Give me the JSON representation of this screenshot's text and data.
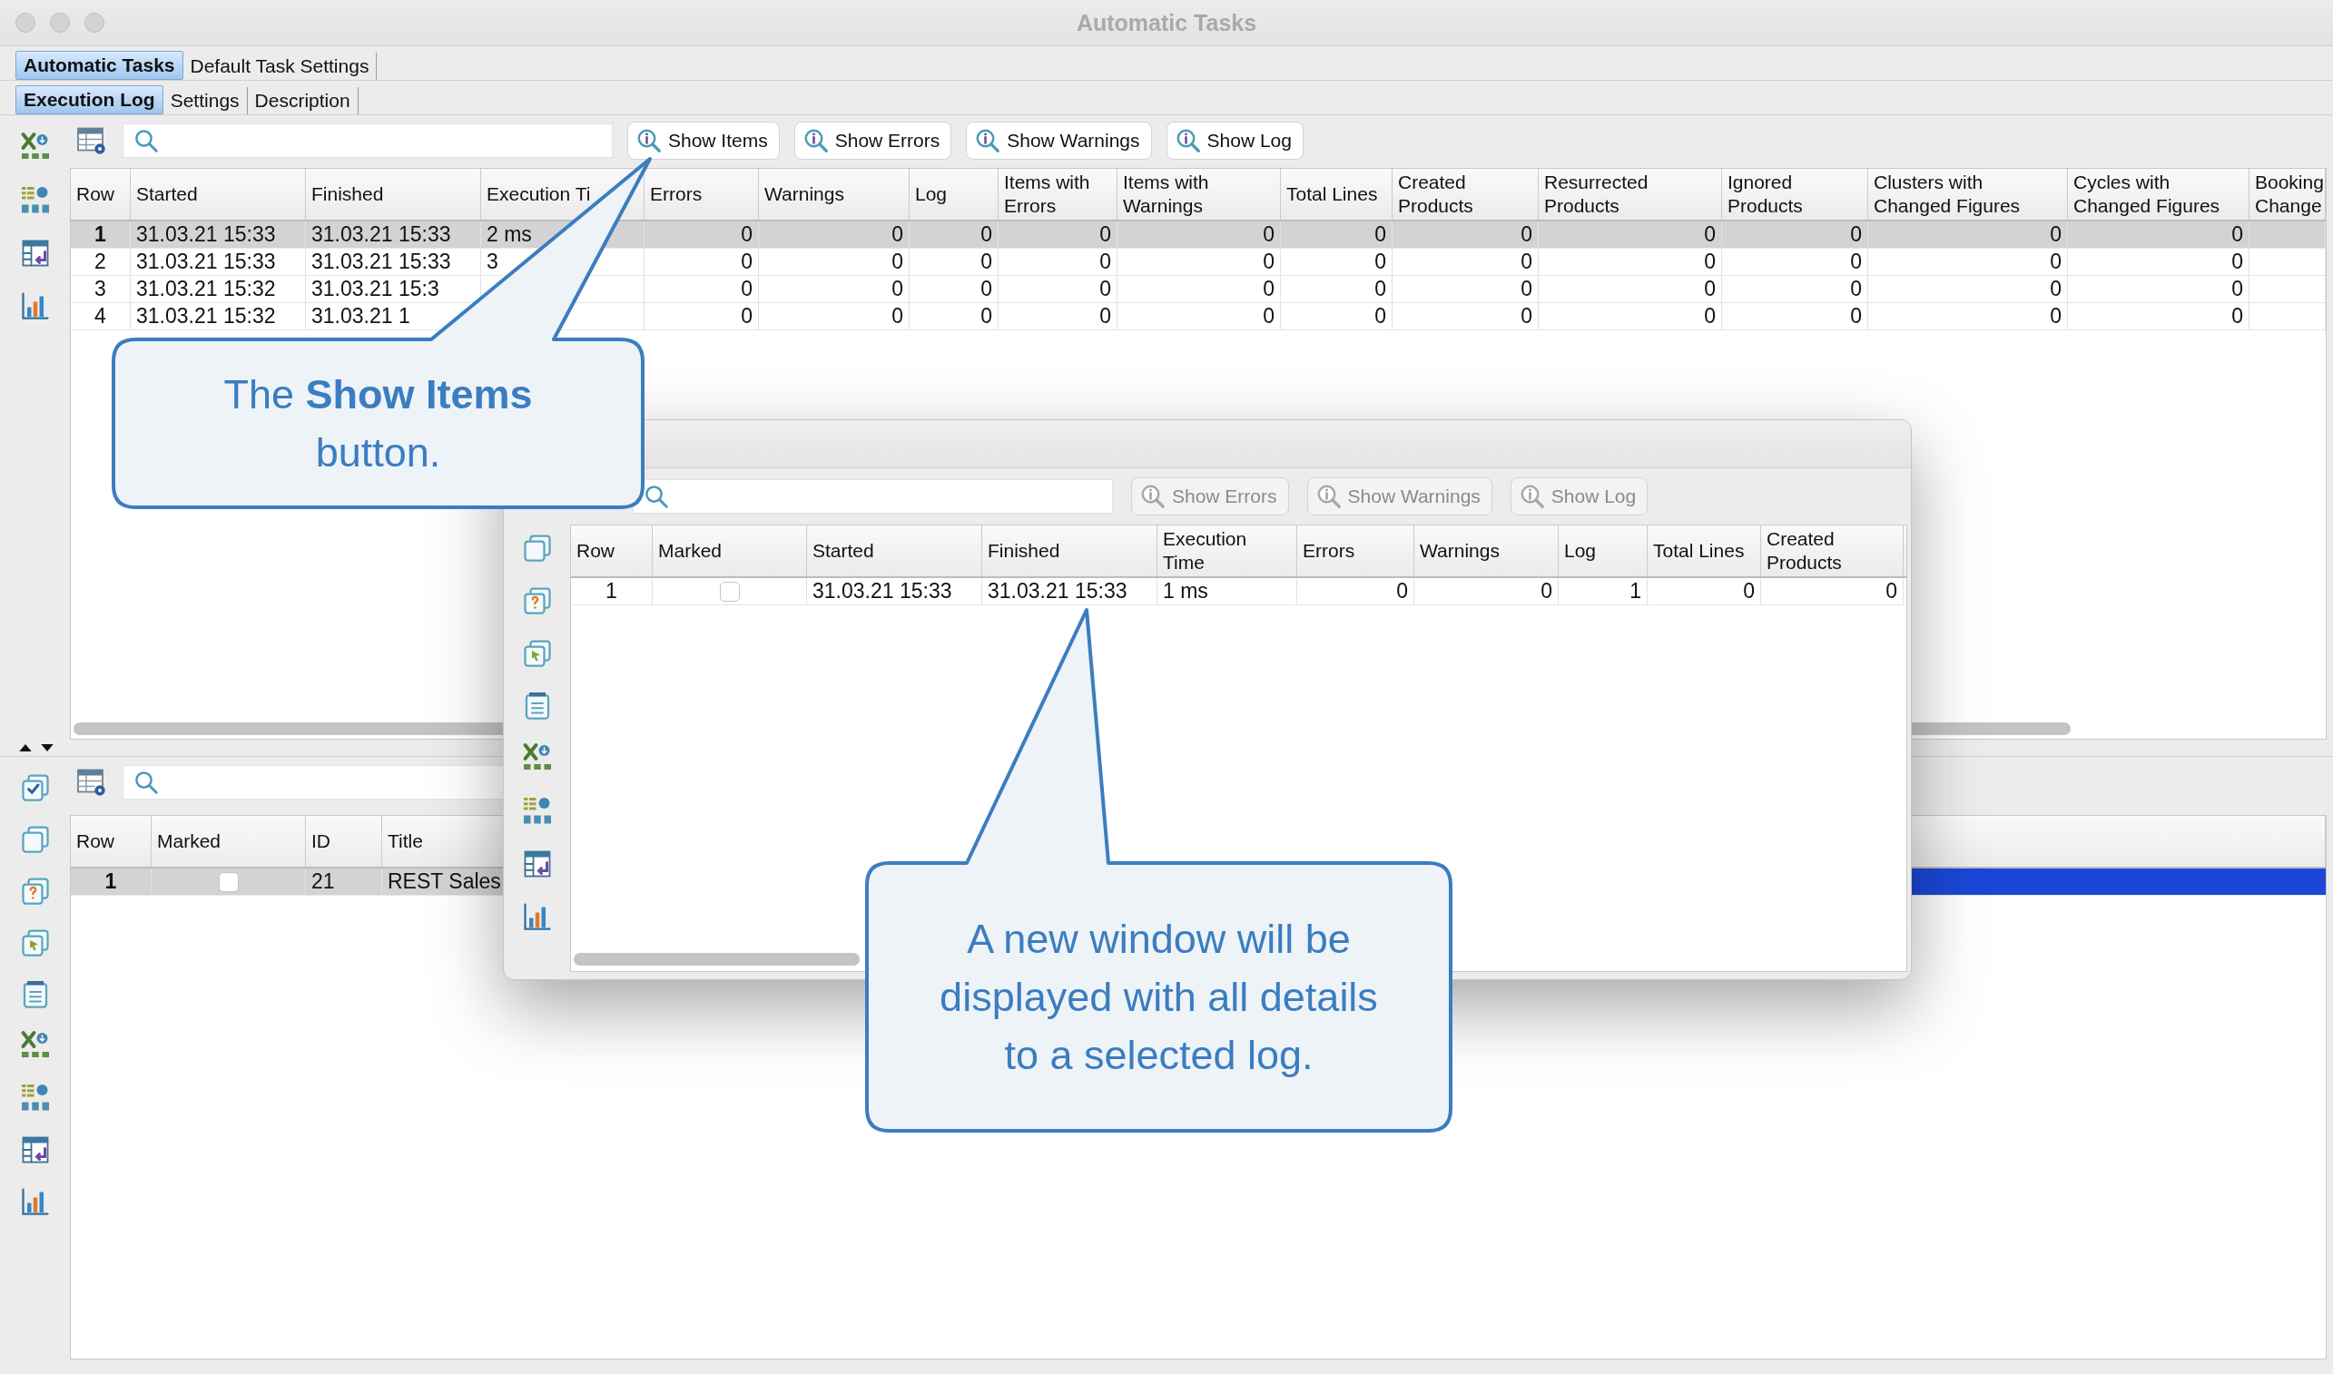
{
  "window": {
    "title": "Automatic Tasks"
  },
  "tabs": [
    {
      "label": "Automatic Tasks",
      "selected": true
    },
    {
      "label": "Default Task Settings",
      "selected": false
    }
  ],
  "subtabs": [
    {
      "label": "Execution Log",
      "selected": true
    },
    {
      "label": "Settings",
      "selected": false
    },
    {
      "label": "Description",
      "selected": false
    }
  ],
  "toolbar": {
    "buttons": [
      {
        "label": "Show Items",
        "disabled": false
      },
      {
        "label": "Show Errors",
        "disabled": false
      },
      {
        "label": "Show Warnings",
        "disabled": false
      },
      {
        "label": "Show Log",
        "disabled": false
      }
    ]
  },
  "log_table": {
    "columns": [
      "Row",
      "Started",
      "Finished",
      "Execution Ti",
      "Errors",
      "Warnings",
      "Log",
      "Items with\nErrors",
      "Items with\nWarnings",
      "Total Lines",
      "Created\nProducts",
      "Resurrected\nProducts",
      "Ignored\nProducts",
      "Clusters with\nChanged Figures",
      "Cycles with\nChanged Figures",
      "Booking\nChange"
    ],
    "rows": [
      {
        "selected": true,
        "cells": [
          "1",
          "31.03.21 15:33",
          "31.03.21 15:33",
          "2 ms",
          "0",
          "0",
          "0",
          "0",
          "0",
          "0",
          "0",
          "0",
          "0",
          "0",
          "0"
        ]
      },
      {
        "selected": false,
        "cells": [
          "2",
          "31.03.21 15:33",
          "31.03.21 15:33",
          "3",
          "0",
          "0",
          "0",
          "0",
          "0",
          "0",
          "0",
          "0",
          "0",
          "0",
          "0"
        ]
      },
      {
        "selected": false,
        "cells": [
          "3",
          "31.03.21 15:32",
          "31.03.21 15:3",
          null,
          "0",
          "0",
          "0",
          "0",
          "0",
          "0",
          "0",
          "0",
          "0",
          "0",
          "0"
        ]
      },
      {
        "selected": false,
        "cells": [
          "4",
          "31.03.21 15:32",
          "31.03.21 1",
          null,
          "0",
          "0",
          "0",
          "0",
          "0",
          "0",
          "0",
          "0",
          "0",
          "0",
          "0"
        ]
      }
    ]
  },
  "items_table": {
    "columns": [
      "Row",
      "Marked",
      "ID",
      "Title"
    ],
    "rows": [
      {
        "selected": true,
        "marked": false,
        "cells": [
          "1",
          null,
          "21",
          "REST Sales"
        ]
      }
    ]
  },
  "dialog": {
    "buttons": [
      {
        "label": "Show Errors",
        "disabled": true
      },
      {
        "label": "Show Warnings",
        "disabled": true
      },
      {
        "label": "Show Log",
        "disabled": true
      }
    ],
    "table": {
      "columns": [
        "Row",
        "Marked",
        "Started",
        "Finished",
        "Execution\nTime",
        "Errors",
        "Warnings",
        "Log",
        "Total Lines",
        "Created\nProducts"
      ],
      "rows": [
        {
          "selected": false,
          "marked": false,
          "cells": [
            "1",
            null,
            "31.03.21 15:33",
            "31.03.21 15:33",
            "1 ms",
            "0",
            "0",
            "1",
            "0",
            "0"
          ]
        }
      ]
    }
  },
  "callouts": [
    {
      "text": "The **Show Items** button."
    },
    {
      "text": "A new window will be displayed with all details to a selected log."
    }
  ]
}
